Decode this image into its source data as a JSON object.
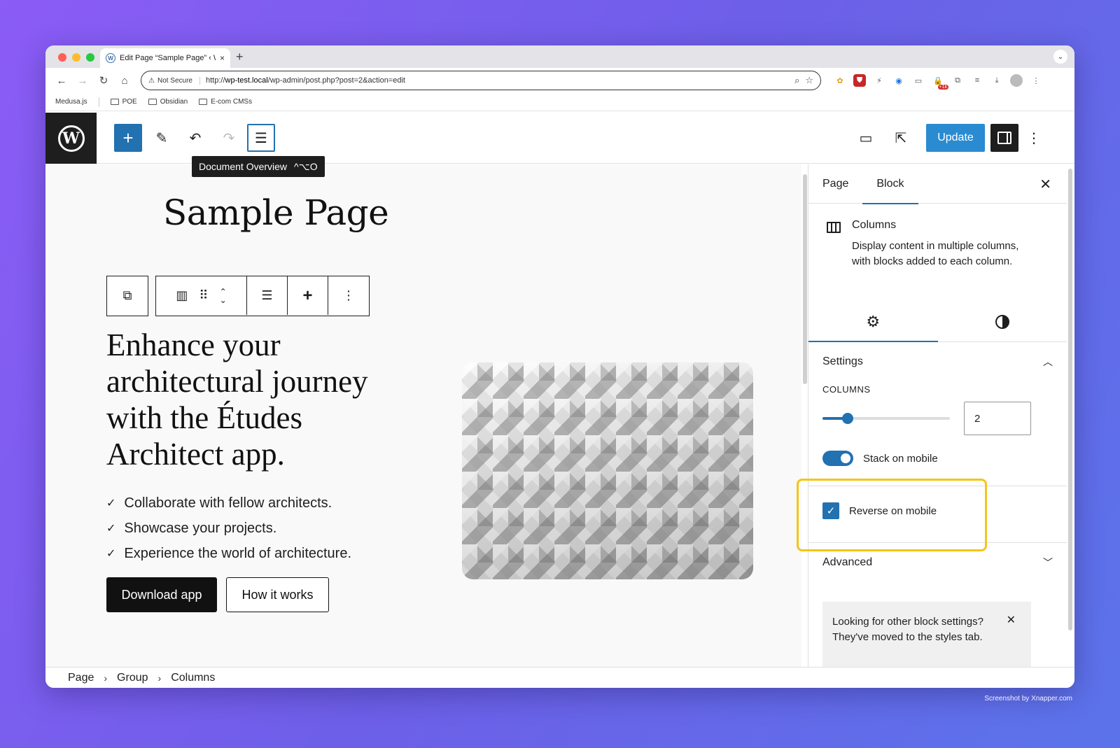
{
  "browser": {
    "tab_title": "Edit Page “Sample Page” ‹ W",
    "tab_close": "×",
    "new_tab": "+",
    "not_secure_label": "Not Secure",
    "url_prefix": "http://",
    "url_host": "wp-test.local",
    "url_path": "/wp-admin/post.php?post=2&action=edit",
    "bookmarks": [
      {
        "label": "Medusa.js"
      },
      {
        "label": "POE"
      },
      {
        "label": "Obsidian"
      },
      {
        "label": "E-com CMSs"
      }
    ],
    "extension_badge": "+1k"
  },
  "editor": {
    "tooltip_label": "Document Overview",
    "tooltip_shortcut": "^⌥O",
    "update_label": "Update",
    "page_title": "Sample Page",
    "headline": "Enhance your architectural journey with the Études Architect app.",
    "checklist": [
      "Collaborate with fellow architects.",
      "Showcase your projects.",
      "Experience the world of architecture."
    ],
    "primary_button": "Download app",
    "secondary_button": "How it works",
    "breadcrumb": [
      "Page",
      "Group",
      "Columns"
    ]
  },
  "sidebar": {
    "tabs": [
      {
        "label": "Page",
        "active": false
      },
      {
        "label": "Block",
        "active": true
      }
    ],
    "block_name": "Columns",
    "block_description": "Display content in multiple columns, with blocks added to each column.",
    "settings_heading": "Settings",
    "columns_label": "COLUMNS",
    "columns_value": "2",
    "columns_slider_fraction": 0.2,
    "stack_on_mobile_label": "Stack on mobile",
    "stack_on_mobile": true,
    "reverse_on_mobile_label": "Reverse on mobile",
    "reverse_on_mobile": true,
    "advanced_heading": "Advanced",
    "notice_text": "Looking for other block settings? They've moved to the styles tab."
  },
  "credit": "Screenshot by Xnapper.com",
  "colors": {
    "wp_blue": "#2271b1",
    "highlight": "#f5c518",
    "traffic_red": "#ff5f57",
    "traffic_yellow": "#febc2e",
    "traffic_green": "#28c840"
  }
}
